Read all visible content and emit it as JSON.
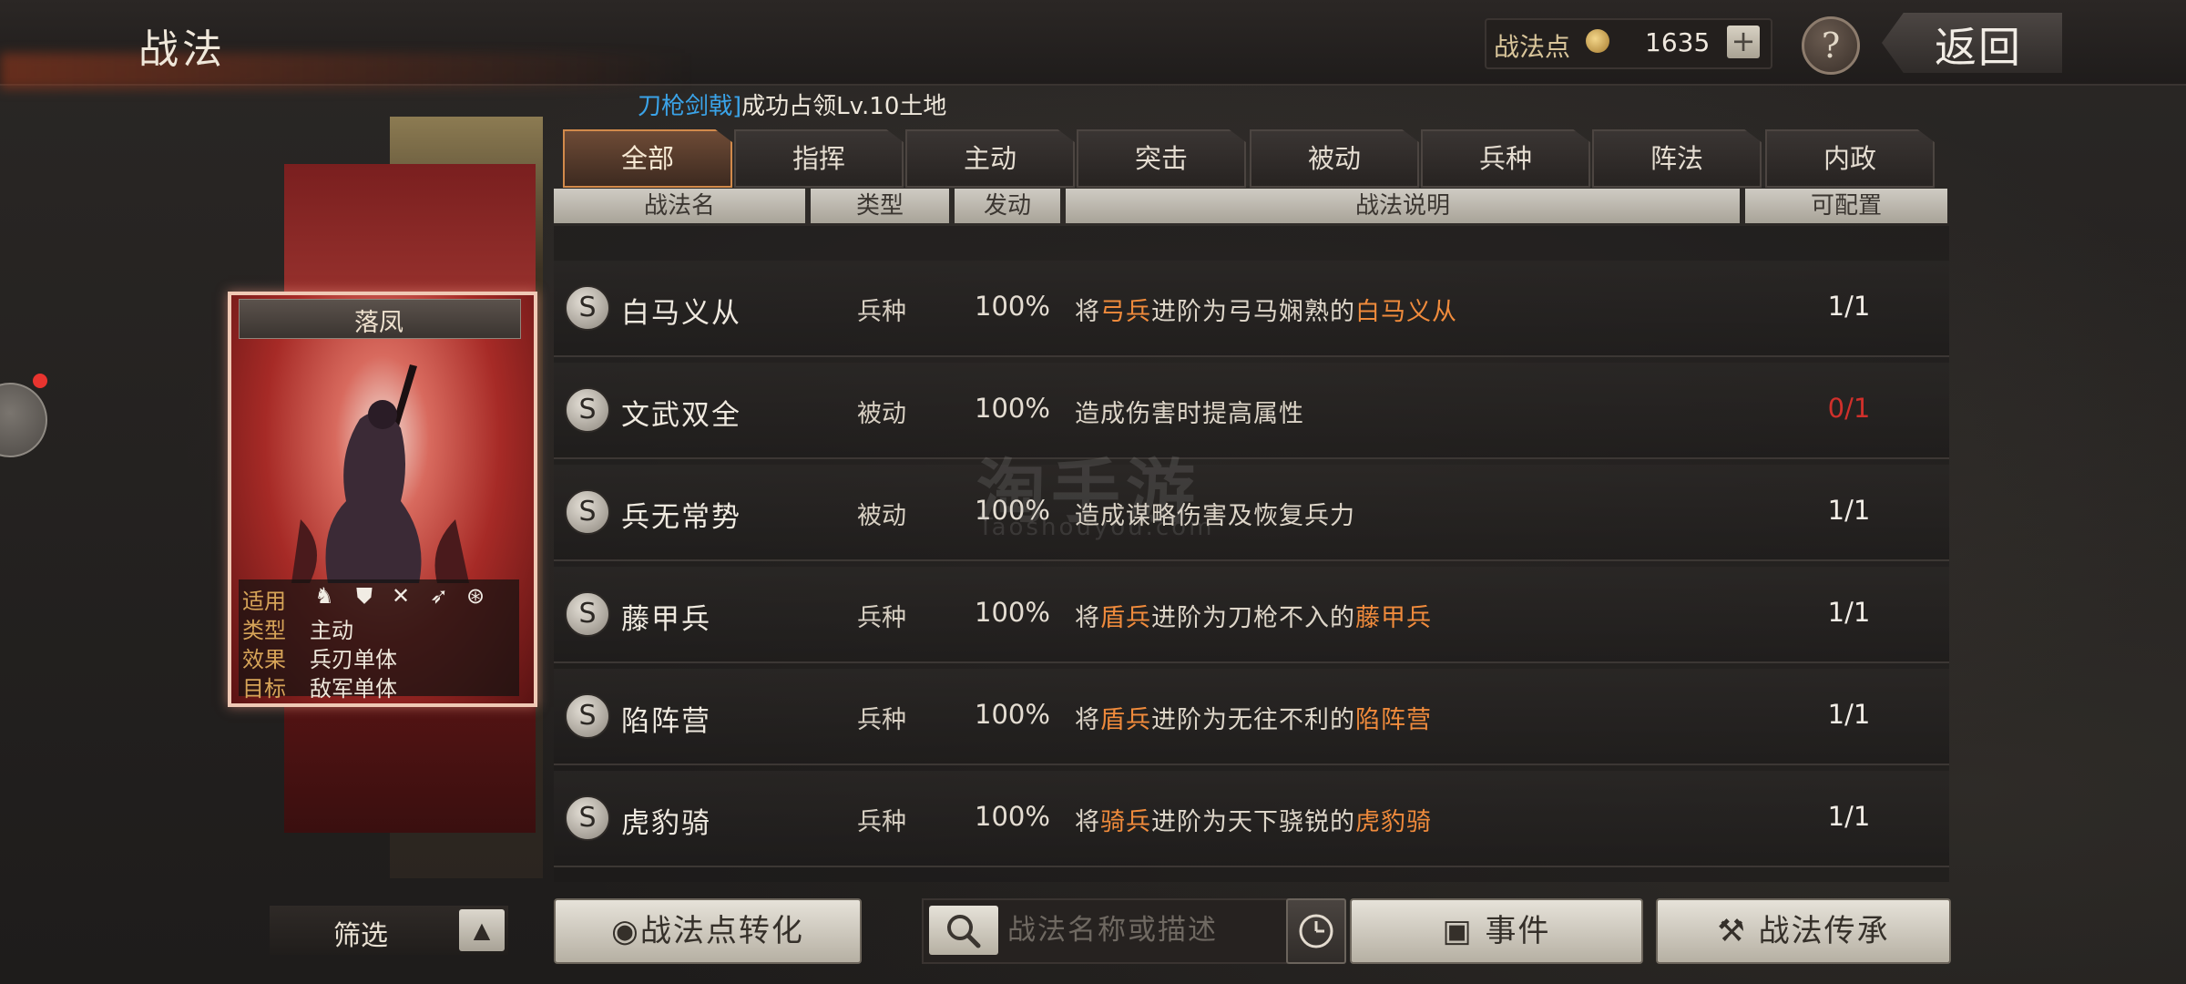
{
  "page_title": "战法",
  "points": {
    "label": "战法点",
    "value": "1635",
    "plus": "+"
  },
  "help_label": "?",
  "back_label": "返回",
  "notice": {
    "clan": "刀枪剑戟]",
    "text": "成功占领Lv.10土地"
  },
  "tabs": [
    {
      "label": "全部"
    },
    {
      "label": "指挥"
    },
    {
      "label": "主动"
    },
    {
      "label": "突击"
    },
    {
      "label": "被动"
    },
    {
      "label": "兵种"
    },
    {
      "label": "阵法"
    },
    {
      "label": "内政"
    }
  ],
  "columns": {
    "name": "战法名",
    "type": "类型",
    "trigger": "发动",
    "desc": "战法说明",
    "config": "可配置"
  },
  "rows": [
    {
      "grade": "S",
      "name": "白马义从",
      "type": "兵种",
      "trigger": "100%",
      "desc_a": "将",
      "desc_hl1": "弓兵",
      "desc_b": "进阶为弓马娴熟的",
      "desc_hl2": "白马义从",
      "config": "1/1",
      "config_red": false
    },
    {
      "grade": "S",
      "name": "文武双全",
      "type": "被动",
      "trigger": "100%",
      "desc_a": "造成伤害时提高属性",
      "desc_hl1": "",
      "desc_b": "",
      "desc_hl2": "",
      "config": "0/1",
      "config_red": true
    },
    {
      "grade": "S",
      "name": "兵无常势",
      "type": "被动",
      "trigger": "100%",
      "desc_a": "造成谋略伤害及恢复兵力",
      "desc_hl1": "",
      "desc_b": "",
      "desc_hl2": "",
      "config": "1/1",
      "config_red": false
    },
    {
      "grade": "S",
      "name": "藤甲兵",
      "type": "兵种",
      "trigger": "100%",
      "desc_a": "将",
      "desc_hl1": "盾兵",
      "desc_b": "进阶为刀枪不入的",
      "desc_hl2": "藤甲兵",
      "config": "1/1",
      "config_red": false
    },
    {
      "grade": "S",
      "name": "陷阵营",
      "type": "兵种",
      "trigger": "100%",
      "desc_a": "将",
      "desc_hl1": "盾兵",
      "desc_b": "进阶为无往不利的",
      "desc_hl2": "陷阵营",
      "config": "1/1",
      "config_red": false
    },
    {
      "grade": "S",
      "name": "虎豹骑",
      "type": "兵种",
      "trigger": "100%",
      "desc_a": "将",
      "desc_hl1": "骑兵",
      "desc_b": "进阶为天下骁锐的",
      "desc_hl2": "虎豹骑",
      "config": "1/1",
      "config_red": false
    }
  ],
  "watermark": {
    "main": "淘手游",
    "sub": "Taoshouyou.com"
  },
  "card": {
    "name": "落凤",
    "apply_label": "适用",
    "apply_icons": [
      "cavalry-icon",
      "shield-icon",
      "bow-icon",
      "spear-icon",
      "siege-icon"
    ],
    "type_label": "类型",
    "type_value": "主动",
    "effect_label": "效果",
    "effect_value": "兵刃单体",
    "target_label": "目标",
    "target_value": "敌军单体"
  },
  "bottom": {
    "filter_label": "筛选",
    "convert_label": "战法点转化",
    "search_placeholder": "战法名称或描述",
    "event_label": "事件",
    "inherit_label": "战法传承"
  },
  "colors": {
    "highlight": "#f08b3c",
    "accent_tab": "#d28a4b",
    "alert": "#d0302b",
    "clan": "#3aa3e8"
  }
}
